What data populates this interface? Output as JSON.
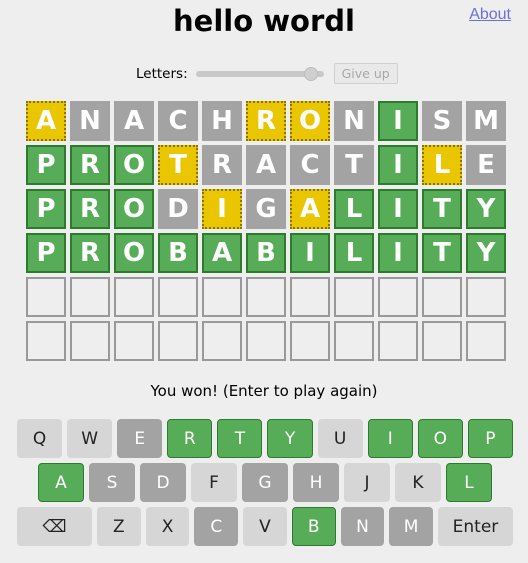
{
  "header": {
    "title": "hello wordl",
    "about_label": "About"
  },
  "controls": {
    "letters_label": "Letters:",
    "give_up_label": "Give up",
    "letters_slider_fraction": 0.92
  },
  "board": {
    "rows": [
      {
        "letters": [
          "A",
          "N",
          "A",
          "C",
          "H",
          "R",
          "O",
          "N",
          "I",
          "S",
          "M"
        ],
        "states": [
          "present",
          "absent",
          "absent",
          "absent",
          "absent",
          "present",
          "present",
          "absent",
          "correct",
          "absent",
          "absent"
        ]
      },
      {
        "letters": [
          "P",
          "R",
          "O",
          "T",
          "R",
          "A",
          "C",
          "T",
          "I",
          "L",
          "E"
        ],
        "states": [
          "correct",
          "correct",
          "correct",
          "present",
          "absent",
          "absent",
          "absent",
          "absent",
          "correct",
          "present",
          "absent"
        ]
      },
      {
        "letters": [
          "P",
          "R",
          "O",
          "D",
          "I",
          "G",
          "A",
          "L",
          "I",
          "T",
          "Y"
        ],
        "states": [
          "correct",
          "correct",
          "correct",
          "absent",
          "present",
          "absent",
          "present",
          "correct",
          "correct",
          "correct",
          "correct"
        ]
      },
      {
        "letters": [
          "P",
          "R",
          "O",
          "B",
          "A",
          "B",
          "I",
          "L",
          "I",
          "T",
          "Y"
        ],
        "states": [
          "correct",
          "correct",
          "correct",
          "correct",
          "correct",
          "correct",
          "correct",
          "correct",
          "correct",
          "correct",
          "correct"
        ]
      },
      {
        "letters": [
          "",
          "",
          "",
          "",
          "",
          "",
          "",
          "",
          "",
          "",
          ""
        ],
        "states": [
          "empty",
          "empty",
          "empty",
          "empty",
          "empty",
          "empty",
          "empty",
          "empty",
          "empty",
          "empty",
          "empty"
        ]
      },
      {
        "letters": [
          "",
          "",
          "",
          "",
          "",
          "",
          "",
          "",
          "",
          "",
          ""
        ],
        "states": [
          "empty",
          "empty",
          "empty",
          "empty",
          "empty",
          "empty",
          "empty",
          "empty",
          "empty",
          "empty",
          "empty"
        ]
      }
    ]
  },
  "status_text": "You won! (Enter to play again)",
  "keyboard": {
    "rows": [
      [
        {
          "label": "Q",
          "state": "unused"
        },
        {
          "label": "W",
          "state": "unused"
        },
        {
          "label": "E",
          "state": "absent"
        },
        {
          "label": "R",
          "state": "correct"
        },
        {
          "label": "T",
          "state": "correct"
        },
        {
          "label": "Y",
          "state": "correct"
        },
        {
          "label": "U",
          "state": "unused"
        },
        {
          "label": "I",
          "state": "correct"
        },
        {
          "label": "O",
          "state": "correct"
        },
        {
          "label": "P",
          "state": "correct"
        }
      ],
      [
        {
          "label": "A",
          "state": "correct"
        },
        {
          "label": "S",
          "state": "absent"
        },
        {
          "label": "D",
          "state": "absent"
        },
        {
          "label": "F",
          "state": "unused"
        },
        {
          "label": "G",
          "state": "absent"
        },
        {
          "label": "H",
          "state": "absent"
        },
        {
          "label": "J",
          "state": "unused"
        },
        {
          "label": "K",
          "state": "unused"
        },
        {
          "label": "L",
          "state": "correct"
        }
      ],
      [
        {
          "label": "⌫",
          "state": "unused",
          "wide": true,
          "name": "backspace"
        },
        {
          "label": "Z",
          "state": "unused"
        },
        {
          "label": "X",
          "state": "unused"
        },
        {
          "label": "C",
          "state": "absent"
        },
        {
          "label": "V",
          "state": "unused"
        },
        {
          "label": "B",
          "state": "correct"
        },
        {
          "label": "N",
          "state": "absent"
        },
        {
          "label": "M",
          "state": "absent"
        },
        {
          "label": "Enter",
          "state": "unused",
          "wide": true,
          "name": "enter"
        }
      ]
    ]
  },
  "colors": {
    "correct": "#57ac57",
    "present": "#e9c600",
    "absent": "#a3a3a3",
    "background": "#eeeeee",
    "link": "#6f6fd8"
  }
}
